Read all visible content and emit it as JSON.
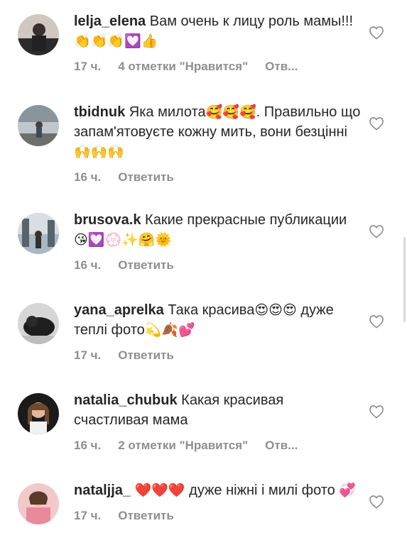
{
  "comments": [
    {
      "username": "lelja_elena",
      "text": "Вам очень к лицу роль мамы!!!",
      "emoji": "👏👏👏💟👍",
      "time": "17 ч.",
      "likes": "4 отметки \"Нравится\"",
      "reply": "Отв..."
    },
    {
      "username": "tbidnuk",
      "text": "Яка милота",
      "emoji": "🥰🥰🥰",
      "text2": ". Правильно що запам'ятовуєте кожну мить, вони безцінні",
      "emoji2": "🙌🙌🙌",
      "time": "16 ч.",
      "reply": "Ответить"
    },
    {
      "username": "brusova.k",
      "text": "Какие прекрасные публикации",
      "emoji": "😘💟💮✨🤗🌞",
      "time": "16 ч.",
      "reply": "Ответить"
    },
    {
      "username": "yana_aprelka",
      "text": "Така красива",
      "emoji": "😍😍😍",
      "text2": " дуже теплі фото",
      "emoji2": "💫🍂💕",
      "time": "17 ч.",
      "reply": "Ответить"
    },
    {
      "username": "natalia_chubuk",
      "text": "Какая красивая счастливая мама",
      "time": "16 ч.",
      "likes": "2 отметки \"Нравится\"",
      "reply": "Отв..."
    },
    {
      "username": "nataljja_",
      "emoji": "❤️❤️❤️",
      "text": " дуже ніжні і милі фото",
      "emoji2": "💞",
      "time": "17 ч.",
      "reply": "Ответить"
    }
  ],
  "icons": {
    "like": "heart-outline-icon",
    "avatar": "avatar-photo"
  }
}
